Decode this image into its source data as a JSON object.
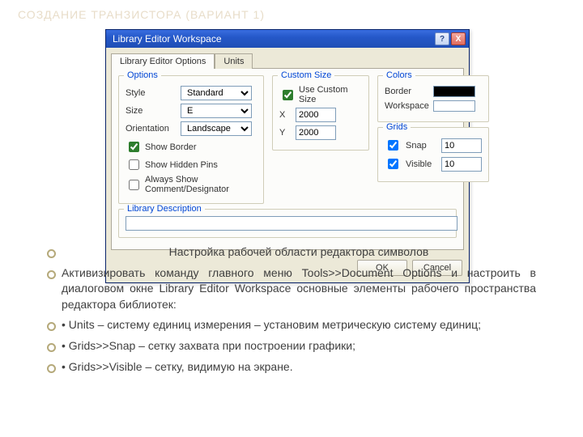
{
  "slide": {
    "title": "СОЗДАНИЕ ТРАНЗИСТОРА (ВАРИАНТ 1)"
  },
  "dialog": {
    "title": "Library Editor Workspace",
    "help": "?",
    "close": "X",
    "tabs": {
      "options": "Library Editor Options",
      "units": "Units"
    },
    "ok": "OK",
    "cancel": "Cancel"
  },
  "options": {
    "group": "Options",
    "style_label": "Style",
    "style_value": "Standard",
    "size_label": "Size",
    "size_value": "E",
    "orient_label": "Orientation",
    "orient_value": "Landscape",
    "show_border": "Show Border",
    "show_hidden": "Show Hidden Pins",
    "always_show": "Always Show Comment/Designator"
  },
  "custom": {
    "group": "Custom Size",
    "use": "Use Custom Size",
    "x_label": "X",
    "x_value": "2000",
    "y_label": "Y",
    "y_value": "2000"
  },
  "colors": {
    "group": "Colors",
    "border_label": "Border",
    "workspace_label": "Workspace",
    "border_hex": "#000000",
    "workspace_hex": "#ffffff"
  },
  "grids": {
    "group": "Grids",
    "snap_label": "Snap",
    "snap_value": "10",
    "visible_label": "Visible",
    "visible_value": "10"
  },
  "libdesc": {
    "group": "Library Description"
  },
  "text": {
    "l1": "Настройка рабочей области редактора символов",
    "l2": "Активизировать команду главного меню Tools>>Document Options и настроить в диалоговом окне Library Editor Workspace основные элементы рабочего пространства редактора библиотек:",
    "l3": "• Units – систему единиц измерения – установим метрическую систему единиц;",
    "l4": "• Grids>>Snap – сетку захвата при построении графики;",
    "l5": "• Grids>>Visible – сетку, видимую на экране."
  }
}
